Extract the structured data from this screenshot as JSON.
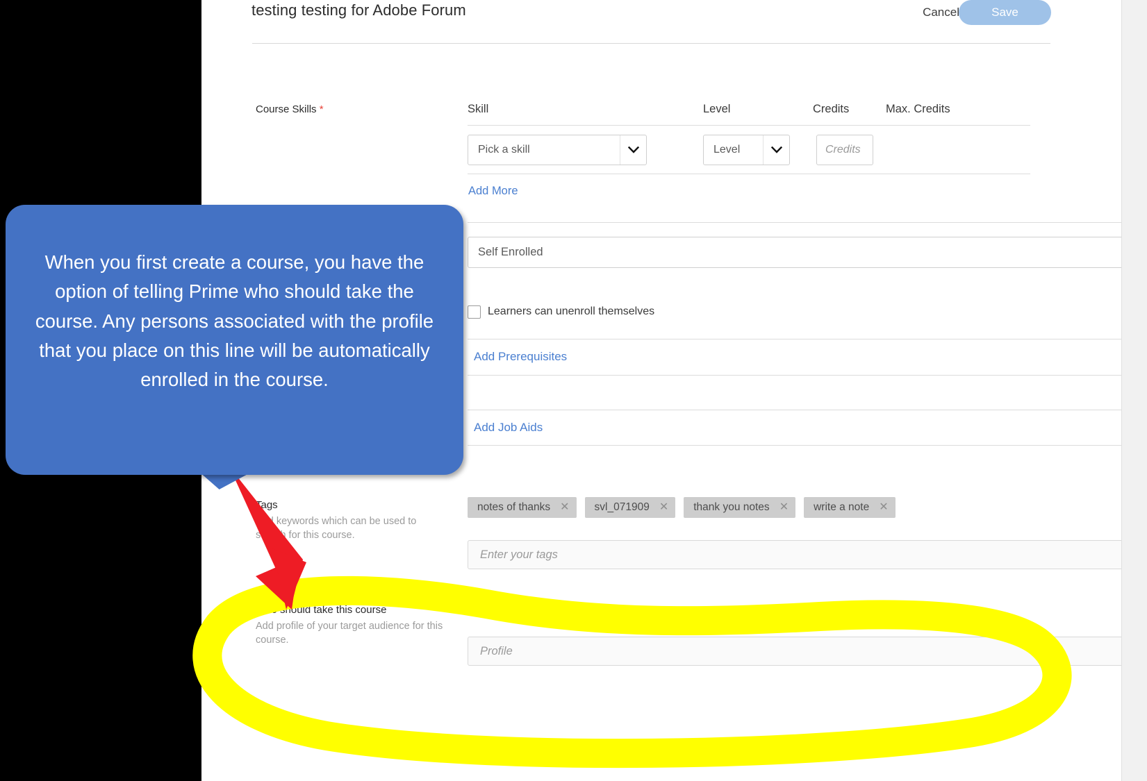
{
  "header": {
    "title": "testing testing for Adobe Forum",
    "cancel_label": "Cancel",
    "save_label": "Save"
  },
  "course_skills": {
    "label": "Course Skills",
    "required_marker": "*",
    "columns": [
      "Skill",
      "Level",
      "Credits",
      "Max. Credits"
    ],
    "row": {
      "skill_value": "Pick a skill",
      "level_value": "Level",
      "credits_placeholder": "Credits",
      "max_credits_value": ""
    },
    "add_more_label": "Add More"
  },
  "enrollment": {
    "type_value": "Self Enrolled",
    "unenroll_label": "Learners can unenroll themselves",
    "unenroll_checked": false
  },
  "rows": [
    {
      "link_label": "Add Prerequisites"
    },
    {
      "link_label": "Add Job Aids"
    }
  ],
  "tags": {
    "label": "Tags",
    "help": "Add keywords which can be used to search for this course.",
    "chips": [
      {
        "text": "notes of thanks",
        "remove_icon": "✕"
      },
      {
        "text": "svl_071909",
        "remove_icon": "✕"
      },
      {
        "text": "thank you notes",
        "remove_icon": "✕"
      },
      {
        "text": "write a note",
        "remove_icon": "✕"
      }
    ],
    "input_placeholder": "Enter your tags"
  },
  "audience": {
    "label": "Who should take this course",
    "help": "Add profile of your target audience for this course.",
    "input_placeholder": "Profile"
  },
  "annotation": {
    "callout_text": "When you first create a course, you have the option of telling Prime who should take the course. Any persons associated with the profile that you place on this line will be automatically enrolled in the course.",
    "callout_color": "#4472c4",
    "arrow_color": "#ee1c25",
    "highlight_color": "#ffff00"
  }
}
